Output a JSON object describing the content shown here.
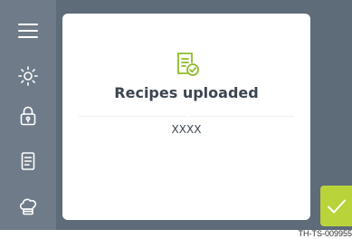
{
  "sidebar": {
    "items": [
      {
        "icon": "menu-icon"
      },
      {
        "icon": "brightness-icon"
      },
      {
        "icon": "lock-icon"
      },
      {
        "icon": "recipe-book-icon"
      },
      {
        "icon": "chef-hat-icon"
      }
    ]
  },
  "dialog": {
    "icon": "recipe-check-icon",
    "title": "Recipes uploaded",
    "value": "XXXX"
  },
  "confirm_button": {
    "icon": "checkmark-icon"
  },
  "reference_code": "TH-TS-009955",
  "colors": {
    "screen_background": "#5e6b79",
    "sidebar_background": "#6f7b88",
    "accent_green": "#b8d43a",
    "dialog_background": "#ffffff",
    "text": "#3d4550"
  }
}
